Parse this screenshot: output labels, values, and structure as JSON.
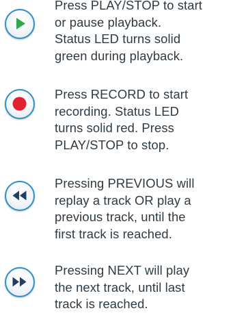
{
  "items": [
    {
      "icon": "play-icon",
      "lines": [
        "Press PLAY/STOP to start",
        "or pause playback.",
        "Status LED turns solid",
        "green during playback."
      ]
    },
    {
      "icon": "record-icon",
      "lines": [
        "Press RECORD to start",
        "recording. Status LED",
        "turns solid red. Press",
        "PLAY/STOP to stop."
      ]
    },
    {
      "icon": "previous-icon",
      "lines": [
        "Pressing PREVIOUS will",
        "replay a track OR play a",
        "previous track, until the",
        "first track is reached."
      ]
    },
    {
      "icon": "next-icon",
      "lines": [
        "Pressing NEXT will play",
        "the next track, until last",
        "track is reached."
      ]
    }
  ],
  "colors": {
    "text": "#2f3a43",
    "ring": "#2c8fc8",
    "play": "#2fa84f",
    "record": "#e5202e",
    "arrows": "#1f3f66"
  }
}
